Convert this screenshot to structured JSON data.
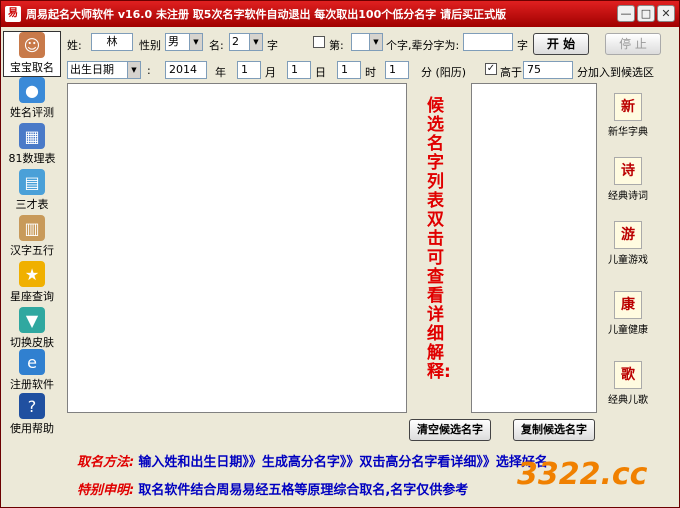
{
  "window": {
    "title": "周易起名大师软件 v16.0  未注册  取5次名字软件自动退出  每次取出100个低分名字 请后买正式版",
    "icon_glyph": "易",
    "min_glyph": "—",
    "max_glyph": "□",
    "close_glyph": "✕"
  },
  "sidebar": {
    "items": [
      {
        "label": "宝宝取名",
        "icon": "baby-icon",
        "color": "#c87a4a"
      },
      {
        "label": "姓名评测",
        "icon": "people-icon",
        "color": "#3a8ad8"
      },
      {
        "label": "81数理表",
        "icon": "table-icon",
        "color": "#4a7ac8"
      },
      {
        "label": "三才表",
        "icon": "grid-icon",
        "color": "#4aa0d8"
      },
      {
        "label": "汉字五行",
        "icon": "book-icon",
        "color": "#c89a5a"
      },
      {
        "label": "星座查询",
        "icon": "star-icon",
        "color": "#f0b000"
      },
      {
        "label": "切换皮肤",
        "icon": "shirt-icon",
        "color": "#30a8a0"
      },
      {
        "label": "注册软件",
        "icon": "ie-icon",
        "color": "#3080d0"
      },
      {
        "label": "使用帮助",
        "icon": "help-icon",
        "color": "#2050a0"
      }
    ]
  },
  "form": {
    "surname_label": "姓:",
    "surname_value": "林",
    "gender_label": "性别",
    "gender_value": "男",
    "name_label": "名:",
    "name_len_value": "2",
    "name_unit": "字",
    "fixed_char_label": "第:",
    "fixed_char_value": "",
    "fixed_char_unit": "个字,辈分字为:",
    "generation_value": "",
    "generation_unit": "字",
    "start_button": "开 始",
    "stop_button": "停 止",
    "date_type_value": "出生日期",
    "colon": ":",
    "year_value": "2014",
    "year_unit": "年",
    "month_value": "1",
    "month_unit": "月",
    "day_value": "1",
    "day_unit": "日",
    "hour_value": "1",
    "hour_unit": "时",
    "minute_value": "1",
    "minute_unit": "分  (阳历)",
    "score_check_label": "高于",
    "score_value": "75",
    "score_unit": "分加入到候选区"
  },
  "main": {
    "hint_text": "候选名字列表双击可查看详细解释:",
    "clear_button": "清空候选名字",
    "copy_button": "复制候选名字"
  },
  "right_tools": [
    {
      "label": "新华字典",
      "glyph": "新"
    },
    {
      "label": "经典诗词",
      "glyph": "诗"
    },
    {
      "label": "儿童游戏",
      "glyph": "游"
    },
    {
      "label": "儿童健康",
      "glyph": "康"
    },
    {
      "label": "经典儿歌",
      "glyph": "歌"
    }
  ],
  "footer": {
    "method_label": "取名方法:",
    "method_text": "输入姓和出生日期》》生成高分名字》》双击高分名字看详细》》选择好名",
    "notice_label": "特别申明:",
    "notice_text": "取名软件结合周易易经五格等原理综合取名,名字仅供参考",
    "watermark": "3322.cc"
  },
  "colors": {
    "title_bar": "#c00000",
    "accent_red": "#e00000",
    "accent_blue": "#0000c0"
  }
}
